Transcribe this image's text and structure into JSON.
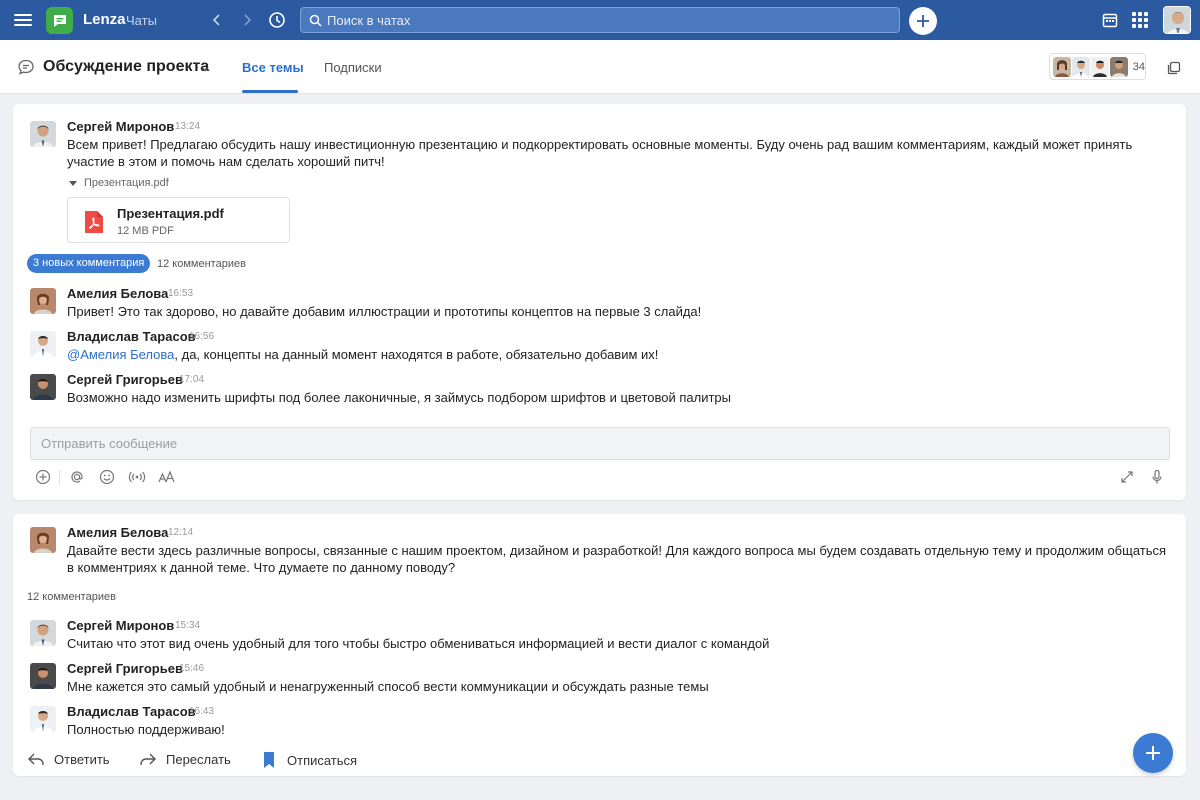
{
  "app": {
    "brand": "Lenza",
    "section": "Чаты",
    "search_placeholder": "Поиск в чатах",
    "icons": [
      "menu-icon",
      "chat-logo-icon",
      "back-icon",
      "forward-icon",
      "history-icon",
      "search-icon",
      "add-icon",
      "calendar-icon",
      "apps-icon"
    ],
    "colors": {
      "topbar": "#2b5aa0",
      "logo": "#3fae49",
      "accent": "#2b6fcb",
      "badge": "#3b7bd4"
    }
  },
  "header": {
    "title": "Обсуждение проекта",
    "tabs": [
      {
        "label": "Все темы",
        "active": true
      },
      {
        "label": "Подписки",
        "active": false
      }
    ],
    "members_count": "34"
  },
  "threads": [
    {
      "author": "Сергей Миронов",
      "time": "13:24",
      "text": "Всем привет! Предлагаю обсудить нашу инвестиционную презентацию и подкорректировать основные моменты. Буду очень рад вашим комментариям, каждый может принять участие в этом и помочь нам сделать хороший питч!",
      "attachment_toggle": "Презентация.pdf",
      "attachment": {
        "name": "Презентация.pdf",
        "meta": "12 MB PDF"
      },
      "new_comments": "3 новых комментария",
      "comments_count": "12 комментариев",
      "comments": [
        {
          "author": "Амелия Белова",
          "time": "16:53",
          "text": "Привет! Это так здорово, но давайте добавим иллюстрации и прототипы концептов на первые 3 слайда!"
        },
        {
          "author": "Владислав Тарасов",
          "time": "16:56",
          "mention": "@Амелия Белова",
          "text": ", да, концепты на данный момент находятся в работе, обязательно добавим их!"
        },
        {
          "author": "Сергей Григорьев",
          "time": "17:04",
          "text": "Возможно надо изменить шрифты под более лаконичные, я займусь подбором шрифтов и цветовой палитры"
        }
      ],
      "compose_placeholder": "Отправить сообщение",
      "compose_tools": [
        "add-attachment-icon",
        "mention-icon",
        "emoji-icon",
        "broadcast-icon",
        "text-format-icon",
        "expand-icon",
        "microphone-icon"
      ]
    },
    {
      "author": "Амелия Белова",
      "time": "12:14",
      "text": "Давайте вести здесь различные вопросы, связанные с нашим проектом, дизайном и разработкой! Для каждого вопроса мы будем создавать отдельную тему и продолжим общаться в комментриях к данной теме. Что думаете по данному поводу?",
      "comments_count": "12 комментариев",
      "comments": [
        {
          "author": "Сергей Миронов",
          "time": "15:34",
          "text": "Считаю что этот вид очень удобный для того чтобы быстро обмениваться информацией и вести диалог с командой"
        },
        {
          "author": "Сергей Григорьев",
          "time": "15:46",
          "text": "Мне кажется это самый удобный и ненагруженный способ вести коммуникации и обсуждать разные темы"
        },
        {
          "author": "Владислав Тарасов",
          "time": "16:43",
          "text": "Полностью поддерживаю!"
        }
      ],
      "actions": [
        {
          "label": "Ответить",
          "icon": "reply-icon"
        },
        {
          "label": "Переслать",
          "icon": "forward-message-icon"
        },
        {
          "label": "Отписаться",
          "icon": "bookmark-icon"
        }
      ]
    }
  ]
}
